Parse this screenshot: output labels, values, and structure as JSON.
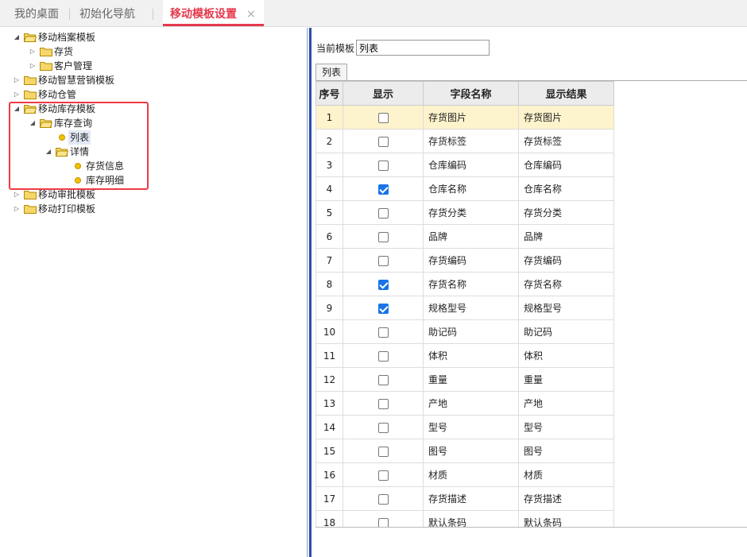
{
  "tabs": [
    {
      "label": "我的桌面"
    },
    {
      "label": "初始化导航"
    },
    {
      "label": "移动模板设置",
      "close": "×"
    }
  ],
  "tree": {
    "n0": "移动档案模板",
    "n1": "存货",
    "n2": "客户管理",
    "n3": "移动智慧营销模板",
    "n4": "移动仓管",
    "n5": "移动库存模板",
    "n6": "库存查询",
    "n7": "列表",
    "n8": "详情",
    "n9": "存货信息",
    "n10": "库存明细",
    "n11": "移动审批模板",
    "n12": "移动打印模板"
  },
  "form": {
    "current_label": "当前模板",
    "current_value": "列表",
    "subtab": "列表"
  },
  "grid": {
    "headers": [
      "序号",
      "显示",
      "字段名称",
      "显示结果"
    ],
    "rows": [
      {
        "no": "1",
        "checked": false,
        "field": "存货图片",
        "result": "存货图片"
      },
      {
        "no": "2",
        "checked": false,
        "field": "存货标签",
        "result": "存货标签"
      },
      {
        "no": "3",
        "checked": false,
        "field": "仓库编码",
        "result": "仓库编码"
      },
      {
        "no": "4",
        "checked": true,
        "field": "仓库名称",
        "result": "仓库名称"
      },
      {
        "no": "5",
        "checked": false,
        "field": "存货分类",
        "result": "存货分类"
      },
      {
        "no": "6",
        "checked": false,
        "field": "品牌",
        "result": "品牌"
      },
      {
        "no": "7",
        "checked": false,
        "field": "存货编码",
        "result": "存货编码"
      },
      {
        "no": "8",
        "checked": true,
        "field": "存货名称",
        "result": "存货名称"
      },
      {
        "no": "9",
        "checked": true,
        "field": "规格型号",
        "result": "规格型号"
      },
      {
        "no": "10",
        "checked": false,
        "field": "助记码",
        "result": "助记码"
      },
      {
        "no": "11",
        "checked": false,
        "field": "体积",
        "result": "体积"
      },
      {
        "no": "12",
        "checked": false,
        "field": "重量",
        "result": "重量"
      },
      {
        "no": "13",
        "checked": false,
        "field": "产地",
        "result": "产地"
      },
      {
        "no": "14",
        "checked": false,
        "field": "型号",
        "result": "型号"
      },
      {
        "no": "15",
        "checked": false,
        "field": "图号",
        "result": "图号"
      },
      {
        "no": "16",
        "checked": false,
        "field": "材质",
        "result": "材质"
      },
      {
        "no": "17",
        "checked": false,
        "field": "存货描述",
        "result": "存货描述"
      },
      {
        "no": "18",
        "checked": false,
        "field": "默认条码",
        "result": "默认条码"
      }
    ]
  },
  "colors": {
    "accent": "#e53a4d",
    "highlight_box": "#ee3a46",
    "selected_row": "#fdf3cc",
    "checkbox_on": "#1a73e8"
  }
}
